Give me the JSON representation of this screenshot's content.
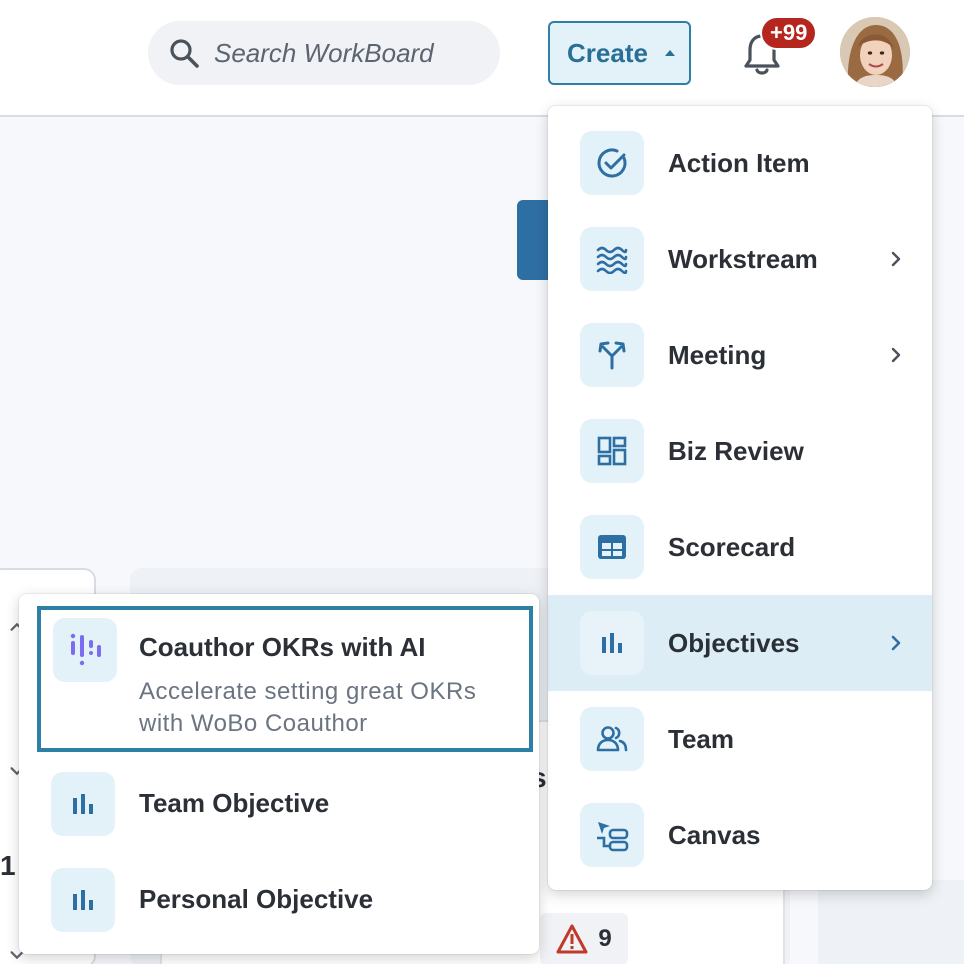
{
  "header": {
    "search_placeholder": "Search WorkBoard",
    "create_label": "Create",
    "notification_count": "+99"
  },
  "create_menu": {
    "items": [
      {
        "label": "Action Item",
        "icon": "check-circle-icon",
        "has_submenu": false
      },
      {
        "label": "Workstream",
        "icon": "waves-icon",
        "has_submenu": true
      },
      {
        "label": "Meeting",
        "icon": "split-arrows-icon",
        "has_submenu": true
      },
      {
        "label": "Biz Review",
        "icon": "dashboard-grid-icon",
        "has_submenu": false
      },
      {
        "label": "Scorecard",
        "icon": "table-icon",
        "has_submenu": false
      },
      {
        "label": "Objectives",
        "icon": "bar-chart-icon",
        "has_submenu": true,
        "active": true
      },
      {
        "label": "Team",
        "icon": "people-icon",
        "has_submenu": false
      },
      {
        "label": "Canvas",
        "icon": "canvas-icon",
        "has_submenu": false
      }
    ]
  },
  "objectives_submenu": {
    "ai": {
      "title": "Coauthor OKRs with AI",
      "description": "Accelerate setting great OKRs with WoBo Coauthor",
      "icon": "ai-sparkle-icon"
    },
    "items": [
      {
        "label": "Team Objective",
        "icon": "bar-chart-icon"
      },
      {
        "label": "Personal Objective",
        "icon": "bar-chart-icon"
      }
    ]
  },
  "background": {
    "fragment_s": "s",
    "fragment_1": "1",
    "warning_count": "9"
  },
  "colors": {
    "accent": "#2e7fa8",
    "icon_bg": "#e3f1f8",
    "active_row": "#dcedf6",
    "badge": "#b5261e",
    "ai_icon": "#7b6cf0"
  }
}
